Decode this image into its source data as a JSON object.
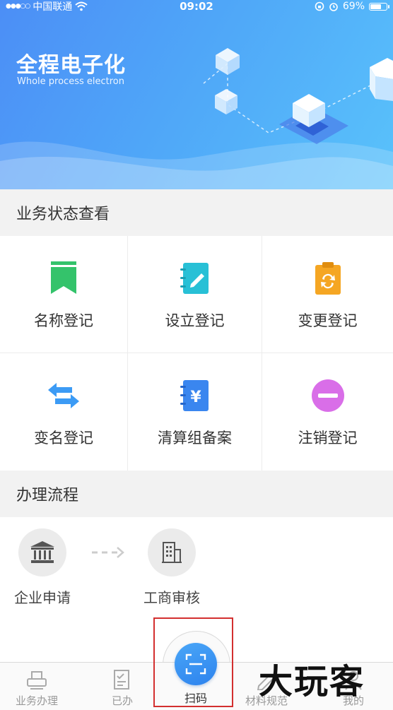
{
  "status_bar": {
    "carrier": "中国联通",
    "time": "09:02",
    "battery": "69%"
  },
  "banner": {
    "title": "全程电子化",
    "subtitle": "Whole process electron"
  },
  "sections": {
    "status_check": "业务状态查看",
    "process_flow": "办理流程"
  },
  "grid": {
    "items": [
      {
        "label": "名称登记",
        "icon": "bookmark-icon",
        "color": "#34c36b"
      },
      {
        "label": "设立登记",
        "icon": "notebook-pen-icon",
        "color": "#28c0d6"
      },
      {
        "label": "变更登记",
        "icon": "clipboard-refresh-icon",
        "color": "#f5a623"
      },
      {
        "label": "变名登记",
        "icon": "swap-arrows-icon",
        "color": "#3c9bf5"
      },
      {
        "label": "清算组备案",
        "icon": "notebook-yen-icon",
        "color": "#3a86ef"
      },
      {
        "label": "注销登记",
        "icon": "minus-circle-icon",
        "color": "#d96ee8"
      }
    ]
  },
  "process": {
    "steps": [
      {
        "label": "企业申请",
        "icon": "bank-icon"
      },
      {
        "label": "工商审核",
        "icon": "office-building-icon"
      }
    ]
  },
  "tabbar": {
    "tabs": [
      {
        "label": "业务办理",
        "icon": "printer-icon"
      },
      {
        "label": "已办",
        "icon": "checklist-icon"
      },
      {
        "label": "扫码",
        "icon": "scan-icon"
      },
      {
        "label": "材料规范",
        "icon": "pencil-icon"
      },
      {
        "label": "我的",
        "icon": "user-icon"
      }
    ]
  },
  "watermark": "大玩客",
  "colors": {
    "accent": "#3a8cf3",
    "highlight_box": "#d32f2f"
  }
}
